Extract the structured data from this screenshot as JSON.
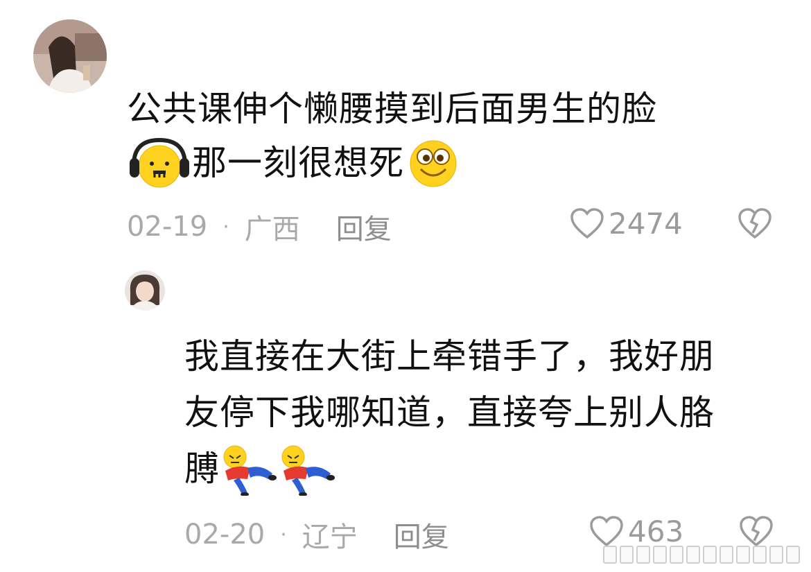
{
  "comments": [
    {
      "text_line1": "公共课伸个懒腰摸到后面男生的脸",
      "text_line2": "那一刻很想死",
      "date": "02-19",
      "separator": "·",
      "location": "广西",
      "reply": "回复",
      "likes": "2474"
    },
    {
      "text_line1": "我直接在大街上牵错手了，我好朋",
      "text_line2": "友停下我哪知道，直接夸上别人胳",
      "text_line3": "膊",
      "date": "02-20",
      "separator": "·",
      "location": "辽宁",
      "reply": "回复",
      "likes": "463"
    }
  ],
  "icons": {
    "like": "heart-outline-icon",
    "dislike": "broken-heart-icon",
    "emoji_1": "headphones-face-emoji",
    "emoji_2": "grinning-face-emoji",
    "emoji_3": "lying-down-emoji"
  }
}
